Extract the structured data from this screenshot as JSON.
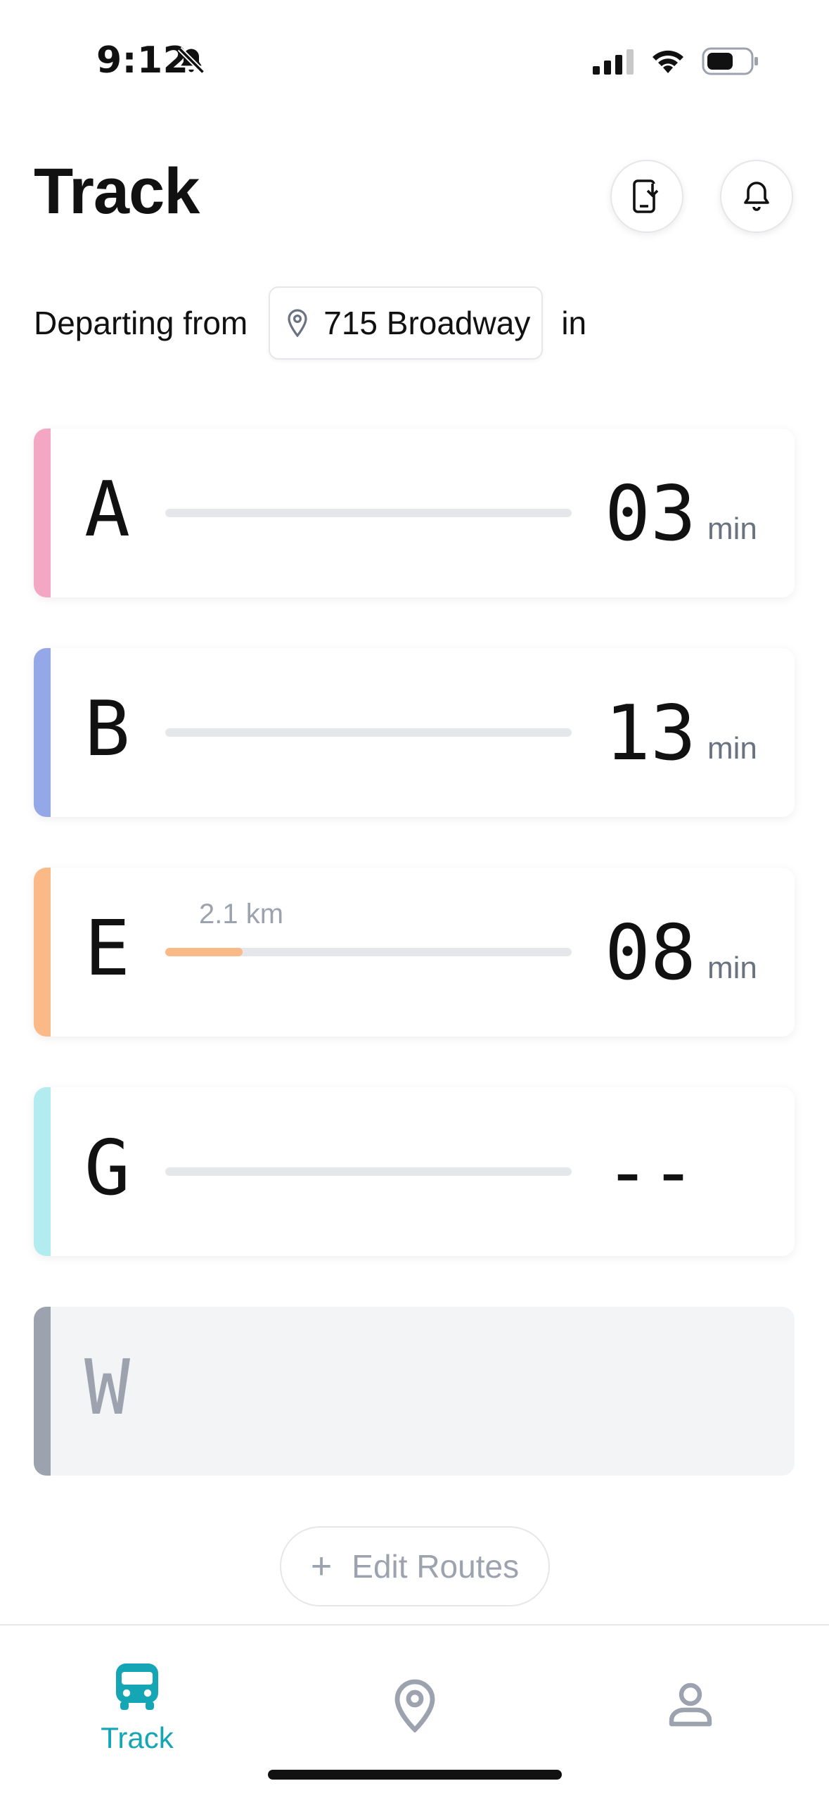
{
  "status_bar": {
    "time": "9:12"
  },
  "header": {
    "title": "Track"
  },
  "departing": {
    "prefix": "Departing from",
    "location": "715 Broadway",
    "suffix": "in"
  },
  "routes": [
    {
      "letter": "A",
      "color": "#f4a7c3",
      "eta": "03",
      "unit": "min",
      "progress": 0,
      "distance": ""
    },
    {
      "letter": "B",
      "color": "#94a8e8",
      "eta": "13",
      "unit": "min",
      "progress": 0,
      "distance": ""
    },
    {
      "letter": "E",
      "color": "#fbb987",
      "eta": "08",
      "unit": "min",
      "progress": 0.19,
      "distance": "2.1 km"
    },
    {
      "letter": "G",
      "color": "#b3ecf0",
      "eta": "--",
      "unit": "",
      "progress": 0,
      "distance": ""
    },
    {
      "letter": "W",
      "color": "#9ca3af",
      "eta": "",
      "unit": "",
      "progress": 0,
      "distance": ""
    }
  ],
  "edit_routes": {
    "plus": "+",
    "label": "Edit Routes"
  },
  "tab_bar": {
    "track_label": "Track",
    "active_color": "#14a6b4",
    "inactive_color": "#9ca3af"
  }
}
